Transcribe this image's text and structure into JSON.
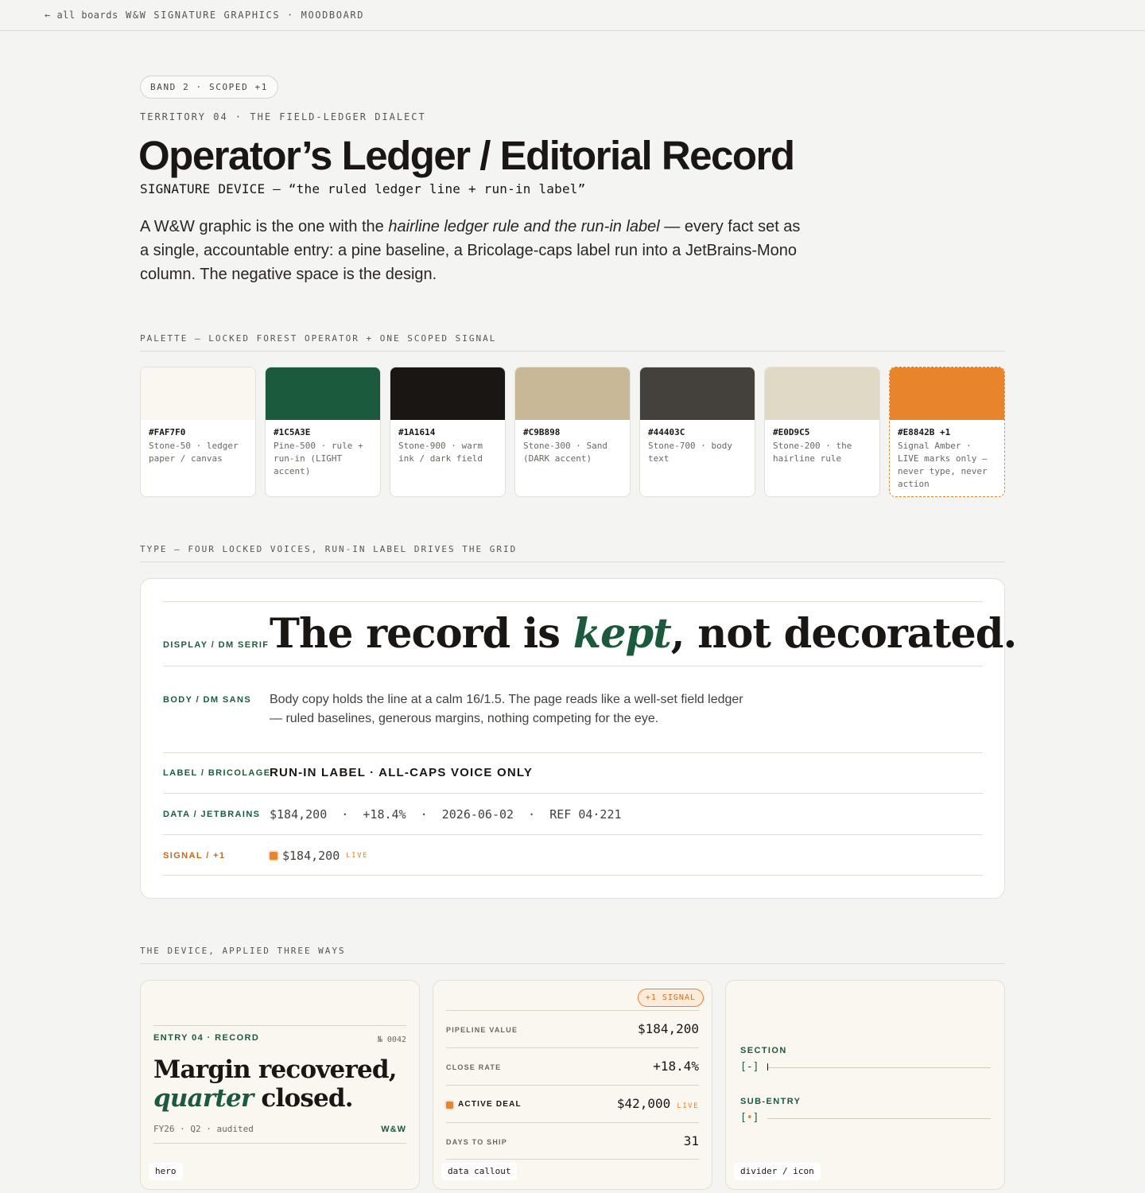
{
  "nav": {
    "back": "← all boards",
    "crumb": "W&W SIGNATURE GRAPHICS · MOODBOARD"
  },
  "header": {
    "badge": "BAND 2 · SCOPED +1",
    "territory": "TERRITORY 04 · THE FIELD-LEDGER DIALECT",
    "title": "Operator’s Ledger / Editorial Record",
    "signature": "SIGNATURE DEVICE — “the ruled ledger line + run-in label”",
    "intro_pre": "A W&W graphic is the one with the ",
    "intro_em": "hairline ledger rule and the run-in label",
    "intro_post": " — every fact set as a single, accountable entry: a pine baseline, a Bricolage-caps label run into a JetBrains-Mono column. The negative space is the design."
  },
  "palette": {
    "heading": "PALETTE — LOCKED FOREST OPERATOR + ONE SCOPED SIGNAL",
    "swatches": [
      {
        "hex": "#FAF7F0",
        "desc": "Stone-50 · ledger paper / canvas",
        "color": "#FAF7F0"
      },
      {
        "hex": "#1C5A3E",
        "desc": "Pine-500 · rule + run-in (LIGHT accent)",
        "color": "#1C5A3E"
      },
      {
        "hex": "#1A1614",
        "desc": "Stone-900 · warm ink / dark field",
        "color": "#1A1614"
      },
      {
        "hex": "#C9B898",
        "desc": "Stone-300 · Sand (DARK accent)",
        "color": "#C9B898"
      },
      {
        "hex": "#44403C",
        "desc": "Stone-700 · body text",
        "color": "#44403C"
      },
      {
        "hex": "#E0D9C5",
        "desc": "Stone-200 · the hairline rule",
        "color": "#E0D9C5"
      },
      {
        "hex": "#E8842B +1",
        "desc": "Signal Amber · LIVE marks only — never type, never action",
        "color": "#E8842B"
      }
    ]
  },
  "type": {
    "heading": "TYPE — FOUR LOCKED VOICES, RUN-IN LABEL DRIVES THE GRID",
    "display_label": "DISPLAY / DM SERIF",
    "display_pre": "The record is ",
    "display_em": "kept",
    "display_post": ", not decorated.",
    "body_label": "BODY / DM SANS",
    "body_text": "Body copy holds the line at a calm 16/1.5. The page reads like a well-set field ledger — ruled baselines, generous margins, nothing competing for the eye.",
    "label_label": "LABEL / BRICOLAGE",
    "label_text": "RUN-IN LABEL · ALL-CAPS VOICE ONLY",
    "data_label": "DATA / JETBRAINS",
    "data_text": "$184,200  ·  +18.4%  ·  2026-06-02  ·  REF 04·221",
    "signal_label": "SIGNAL / +1",
    "signal_value": "$184,200",
    "signal_live": "LIVE"
  },
  "applied": {
    "heading": "THE DEVICE, APPLIED THREE WAYS",
    "hero": {
      "entry": "ENTRY 04 · RECORD",
      "number": "№ 0042",
      "line1": "Margin recovered,",
      "line2_em": "quarter",
      "line2_post": " closed.",
      "meta": "FY26 · Q2 · audited",
      "mark": "W&W",
      "tag": "hero"
    },
    "callout": {
      "pill": "+1 SIGNAL",
      "rows": [
        {
          "label": "PIPELINE VALUE",
          "value": "$184,200"
        },
        {
          "label": "CLOSE RATE",
          "value": "+18.4%"
        },
        {
          "label": "ACTIVE DEAL",
          "value": "$42,000",
          "live": "LIVE"
        },
        {
          "label": "DAYS TO SHIP",
          "value": "31"
        }
      ],
      "tag": "data callout"
    },
    "divider": {
      "section": "SECTION",
      "section_mark": "[-]",
      "sub": "SUB-ENTRY",
      "sub_open": "[",
      "sub_dot": "•",
      "sub_close": "]",
      "tag": "divider / icon"
    }
  }
}
